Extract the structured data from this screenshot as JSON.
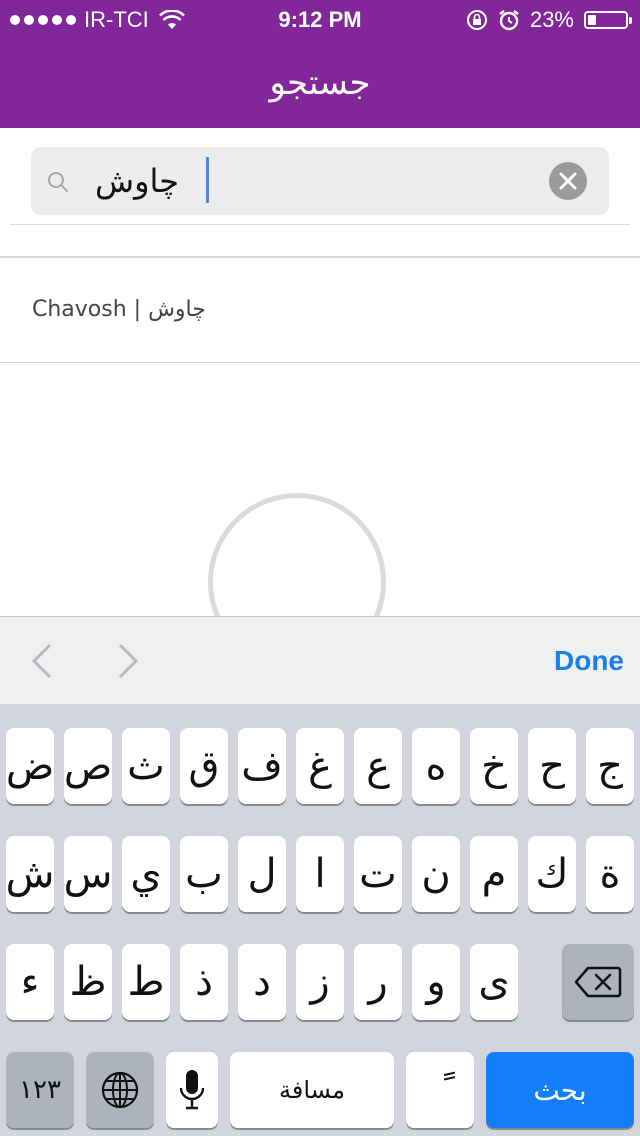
{
  "status_bar": {
    "carrier": "IR-TCI",
    "time": "9:12 PM",
    "battery_percent": "23%",
    "battery_level": 0.23
  },
  "nav": {
    "title": "جستجو"
  },
  "search": {
    "value": "چاوش",
    "placeholder": ""
  },
  "results": [
    {
      "label": "Chavosh | چاوش"
    }
  ],
  "accessory": {
    "done_label": "Done"
  },
  "keyboard": {
    "row1": [
      "ج",
      "ح",
      "خ",
      "ه",
      "ع",
      "غ",
      "ف",
      "ق",
      "ث",
      "ص",
      "ض"
    ],
    "row2": [
      "ة",
      "ك",
      "م",
      "ن",
      "ت",
      "ا",
      "ل",
      "ب",
      "ي",
      "س",
      "ش"
    ],
    "row3": [
      "ى",
      "و",
      "ر",
      "ز",
      "د",
      "ذ",
      "ط",
      "ظ",
      "ء"
    ],
    "numbers_label": "١٢٣",
    "space_label": "مسافة",
    "diacritic_label": "ً",
    "search_label": "بحث"
  },
  "colors": {
    "nav_bg": "#82279a",
    "accent_blue": "#157efb",
    "done_blue": "#1e7ee8"
  }
}
